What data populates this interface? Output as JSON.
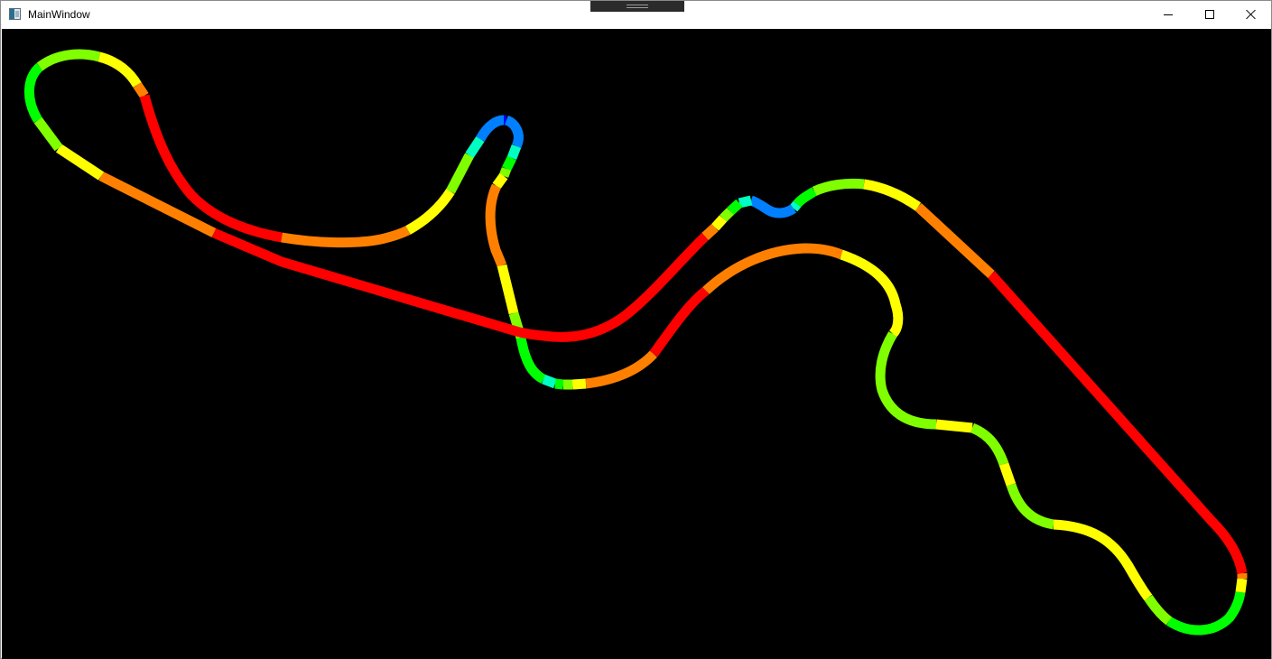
{
  "window": {
    "title": "MainWindow",
    "controls": {
      "minimize_icon": "minimize-icon",
      "maximize_icon": "maximize-icon",
      "close_icon": "close-icon"
    }
  },
  "canvas": {
    "background": "#000000"
  },
  "track_map": {
    "colors": {
      "red": "#ff0000",
      "orange": "#ff8000",
      "yellow": "#ffff00",
      "yellow_green": "#80ff00",
      "green": "#00ff00",
      "cyan": "#00ffc0",
      "light_blue": "#00c0ff",
      "blue": "#0080ff",
      "dark_blue": "#0000ff"
    }
  }
}
